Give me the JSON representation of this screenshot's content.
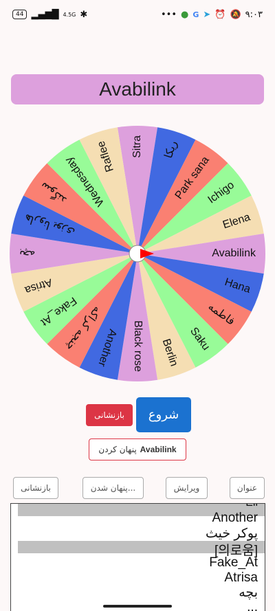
{
  "status_bar": {
    "battery": "44",
    "network": "4.5G",
    "time": "۹:۰۳"
  },
  "app": {
    "title": "Avabilink"
  },
  "wheel": {
    "segments": [
      {
        "label": "Sitra",
        "color": "#dda0dd"
      },
      {
        "label": "ریکا",
        "color": "#4169e1"
      },
      {
        "label": "Park sana",
        "color": "#fa8072"
      },
      {
        "label": "Ichigo",
        "color": "#98fb98"
      },
      {
        "label": "Elena",
        "color": "#f5deb3"
      },
      {
        "label": "Avabilink",
        "color": "#dda0dd"
      },
      {
        "label": "Hana",
        "color": "#4169e1"
      },
      {
        "label": "فاطمه",
        "color": "#fa8072"
      },
      {
        "label": "Saku",
        "color": "#98fb98"
      },
      {
        "label": "Berlin",
        "color": "#f5deb3"
      },
      {
        "label": "Black rose",
        "color": "#dda0dd"
      },
      {
        "label": "Another",
        "color": "#4169e1"
      },
      {
        "label": "ﭼﻨﺠﻪ ﮐﺮﺍﮐﻪ",
        "color": "#fa8072"
      },
      {
        "label": "Fake_At",
        "color": "#98fb98"
      },
      {
        "label": "Atrisa",
        "color": "#f5deb3"
      },
      {
        "label": "ﺑﭽﻪ",
        "color": "#dda0dd"
      },
      {
        "label": "ﻫﺎﺭﻭﻧﺎ ﻳﻮﺯﯼ",
        "color": "#4169e1"
      },
      {
        "label": "ﺳﻮﮔﻨﺪ",
        "color": "#fa8072"
      },
      {
        "label": "Wednesday",
        "color": "#98fb98"
      },
      {
        "label": "Raflee",
        "color": "#f5deb3"
      }
    ],
    "pointer_color": "#ff0000"
  },
  "controls": {
    "start_label": "شروع",
    "reset_label": "بازنشانی",
    "hide_label": "پنهان کردن",
    "hide_name": "Avabilink"
  },
  "toolbar": {
    "title_label": "عنوان",
    "edit_label": "ویرایش",
    "hidden_label": "پنهان شدن...",
    "reset_label": "بازنشانی"
  },
  "names_list": {
    "lines": [
      "Ell",
      "Another",
      "پوکر خیث",
      "[의로움]",
      "Fake_At",
      "Atrisa",
      "بچه",
      "..."
    ]
  }
}
